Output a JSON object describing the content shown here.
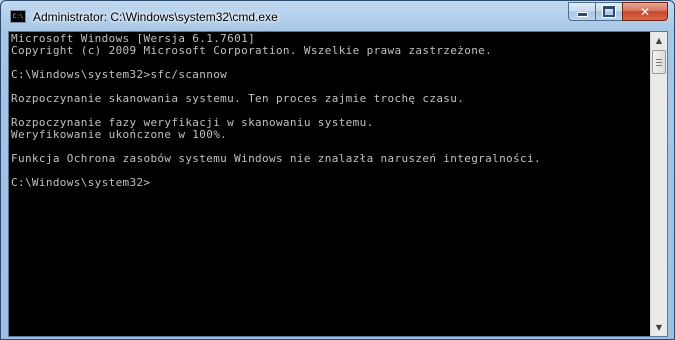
{
  "window": {
    "title": "Administrator: C:\\Windows\\system32\\cmd.exe",
    "icon": "cmd-console-icon",
    "icon_text": "C:\\",
    "buttons": {
      "minimize": "minimize-icon",
      "maximize": "maximize-icon",
      "close": "close-icon",
      "close_glyph": "✕"
    }
  },
  "console": {
    "text_color": "#c0c0c0",
    "background_color": "#000000",
    "lines": [
      "Microsoft Windows [Wersja 6.1.7601]",
      "Copyright (c) 2009 Microsoft Corporation. Wszelkie prawa zastrzeżone.",
      "",
      "C:\\Windows\\system32>sfc/scannow",
      "",
      "Rozpoczynanie skanowania systemu. Ten proces zajmie trochę czasu.",
      "",
      "Rozpoczynanie fazy weryfikacji w skanowaniu systemu.",
      "Weryfikowanie ukończone w 100%.",
      "",
      "Funkcja Ochrona zasobów systemu Windows nie znalazła naruszeń integralności.",
      "",
      "C:\\Windows\\system32>"
    ]
  },
  "scrollbar": {
    "up_arrow": "▲",
    "down_arrow": "▼",
    "position": 0
  },
  "colors": {
    "title_bar": "#a7c6e6",
    "close_button": "#c7472d"
  }
}
